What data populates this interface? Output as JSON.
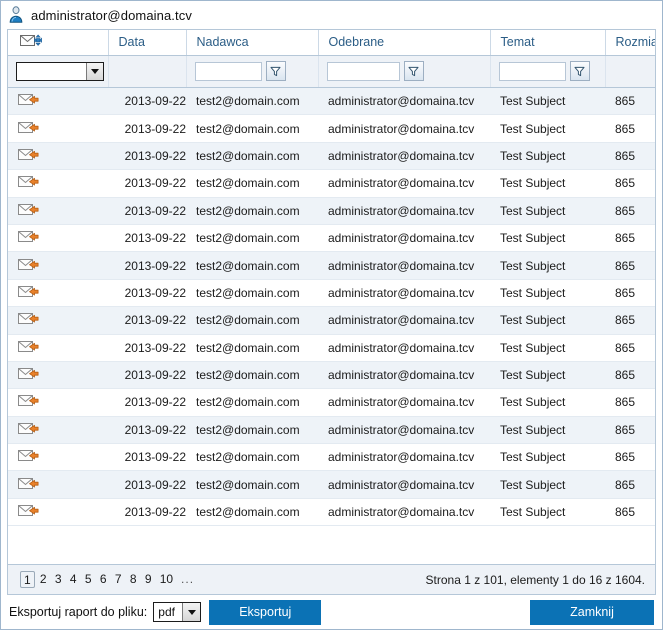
{
  "window": {
    "title": "administrator@domaina.tcv",
    "user_icon": "user-icon"
  },
  "grid": {
    "columns": [
      {
        "key": "icon",
        "label": "",
        "icon": "mail-move-icon"
      },
      {
        "key": "data",
        "label": "Data"
      },
      {
        "key": "nadawca",
        "label": "Nadawca"
      },
      {
        "key": "odebrane",
        "label": "Odebrane"
      },
      {
        "key": "temat",
        "label": "Temat"
      },
      {
        "key": "rozmiar",
        "label": "Rozmiar"
      }
    ],
    "filters": {
      "type_combo_value": "",
      "nadawca_value": "",
      "odebrane_value": "",
      "temat_value": "",
      "filter_button_icon": "funnel-icon"
    },
    "row_icon": "mail-incoming-icon",
    "rows": [
      {
        "data": "2013-09-22",
        "nadawca": "test2@domain.com",
        "odebrane": "administrator@domaina.tcv",
        "temat": "Test Subject",
        "rozmiar": "865"
      },
      {
        "data": "2013-09-22",
        "nadawca": "test2@domain.com",
        "odebrane": "administrator@domaina.tcv",
        "temat": "Test Subject",
        "rozmiar": "865"
      },
      {
        "data": "2013-09-22",
        "nadawca": "test2@domain.com",
        "odebrane": "administrator@domaina.tcv",
        "temat": "Test Subject",
        "rozmiar": "865"
      },
      {
        "data": "2013-09-22",
        "nadawca": "test2@domain.com",
        "odebrane": "administrator@domaina.tcv",
        "temat": "Test Subject",
        "rozmiar": "865"
      },
      {
        "data": "2013-09-22",
        "nadawca": "test2@domain.com",
        "odebrane": "administrator@domaina.tcv",
        "temat": "Test Subject",
        "rozmiar": "865"
      },
      {
        "data": "2013-09-22",
        "nadawca": "test2@domain.com",
        "odebrane": "administrator@domaina.tcv",
        "temat": "Test Subject",
        "rozmiar": "865"
      },
      {
        "data": "2013-09-22",
        "nadawca": "test2@domain.com",
        "odebrane": "administrator@domaina.tcv",
        "temat": "Test Subject",
        "rozmiar": "865"
      },
      {
        "data": "2013-09-22",
        "nadawca": "test2@domain.com",
        "odebrane": "administrator@domaina.tcv",
        "temat": "Test Subject",
        "rozmiar": "865"
      },
      {
        "data": "2013-09-22",
        "nadawca": "test2@domain.com",
        "odebrane": "administrator@domaina.tcv",
        "temat": "Test Subject",
        "rozmiar": "865"
      },
      {
        "data": "2013-09-22",
        "nadawca": "test2@domain.com",
        "odebrane": "administrator@domaina.tcv",
        "temat": "Test Subject",
        "rozmiar": "865"
      },
      {
        "data": "2013-09-22",
        "nadawca": "test2@domain.com",
        "odebrane": "administrator@domaina.tcv",
        "temat": "Test Subject",
        "rozmiar": "865"
      },
      {
        "data": "2013-09-22",
        "nadawca": "test2@domain.com",
        "odebrane": "administrator@domaina.tcv",
        "temat": "Test Subject",
        "rozmiar": "865"
      },
      {
        "data": "2013-09-22",
        "nadawca": "test2@domain.com",
        "odebrane": "administrator@domaina.tcv",
        "temat": "Test Subject",
        "rozmiar": "865"
      },
      {
        "data": "2013-09-22",
        "nadawca": "test2@domain.com",
        "odebrane": "administrator@domaina.tcv",
        "temat": "Test Subject",
        "rozmiar": "865"
      },
      {
        "data": "2013-09-22",
        "nadawca": "test2@domain.com",
        "odebrane": "administrator@domaina.tcv",
        "temat": "Test Subject",
        "rozmiar": "865"
      },
      {
        "data": "2013-09-22",
        "nadawca": "test2@domain.com",
        "odebrane": "administrator@domaina.tcv",
        "temat": "Test Subject",
        "rozmiar": "865"
      }
    ]
  },
  "pager": {
    "pages": [
      "1",
      "2",
      "3",
      "4",
      "5",
      "6",
      "7",
      "8",
      "9",
      "10"
    ],
    "ellipsis": "...",
    "current_page": "1",
    "status": "Strona 1 z 101, elementy 1 do 16 z 1604."
  },
  "bottom": {
    "export_label": "Eksportuj raport do pliku:",
    "format_value": "pdf",
    "export_button": "Eksportuj",
    "close_button": "Zamknij"
  },
  "colors": {
    "accent_blue": "#0b72b5",
    "header_text": "#2b5d86",
    "row_alt": "#eef3f8",
    "panel": "#eef2f7",
    "border": "#b5c7d8",
    "icon_orange": "#e8812b"
  }
}
